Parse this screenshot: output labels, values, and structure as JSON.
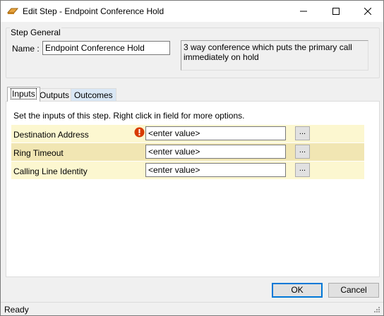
{
  "window": {
    "title": "Edit Step - Endpoint Conference Hold",
    "icon": "step-icon",
    "controls": [
      "minimize-icon",
      "maximize-icon",
      "close-icon"
    ]
  },
  "step_general": {
    "group_label": "Step General",
    "name_label": "Name :",
    "name_value": "Endpoint Conference Hold",
    "description": "3 way conference which puts the primary call immediately on hold"
  },
  "tabs": [
    {
      "label": "Inputs",
      "selected": true
    },
    {
      "label": "Outputs",
      "selected": false
    },
    {
      "label": "Outcomes",
      "selected": false
    }
  ],
  "inputs_panel": {
    "hint": "Set the inputs of this step.  Right click in field for more options.",
    "rows": [
      {
        "label": "Destination Address",
        "value": "<enter value>",
        "required_error": true,
        "button": "..."
      },
      {
        "label": "Ring Timeout",
        "value": "<enter value>",
        "required_error": false,
        "button": "..."
      },
      {
        "label": "Calling Line Identity",
        "value": "<enter value>",
        "required_error": false,
        "button": "..."
      }
    ]
  },
  "buttons": {
    "ok": "OK",
    "cancel": "Cancel"
  },
  "status": {
    "text": "Ready"
  },
  "colors": {
    "row_light": "#fcf7d0",
    "row_dark": "#f1e6b3",
    "error": "#d83b01",
    "focus": "#0078d7"
  }
}
